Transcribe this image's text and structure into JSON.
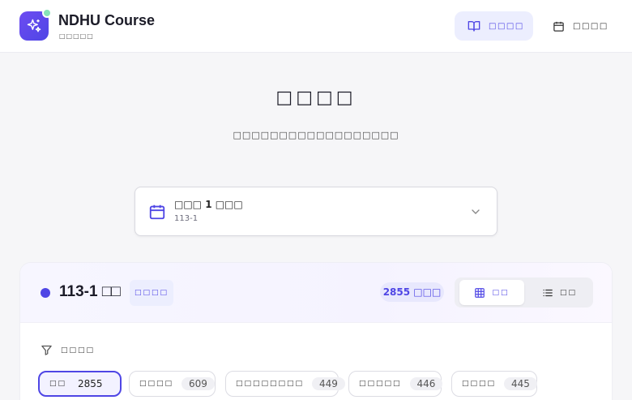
{
  "brand": {
    "title": "NDHU Course",
    "subtitle": "□□□□□"
  },
  "nav": {
    "active_label": "□□□□",
    "other_label": "□□□□"
  },
  "page": {
    "title": "□□□□",
    "subtitle": "□□□□□□□□□□□□□□□□□□"
  },
  "semester_select": {
    "label": "□□□ 1 □□□",
    "code": "113-1"
  },
  "panel": {
    "title": "113-1 □□",
    "badge": "□□□□",
    "count": "2855 □□□",
    "view": {
      "grid_label": "□□",
      "list_label": "□□"
    },
    "filter_label": "□□□□",
    "chips": [
      {
        "label": "□□",
        "count": "2855",
        "active": true
      },
      {
        "label": "□□□□",
        "count": "609",
        "active": false
      },
      {
        "label": "□□□□□□□□",
        "count": "449",
        "active": false
      },
      {
        "label": "□□□□□",
        "count": "446",
        "active": false
      },
      {
        "label": "□□□□",
        "count": "445",
        "active": false
      }
    ]
  },
  "colors": {
    "accent": "#4f46e5",
    "accent_soft": "#eceefe",
    "success_dot": "#86e3b8"
  }
}
